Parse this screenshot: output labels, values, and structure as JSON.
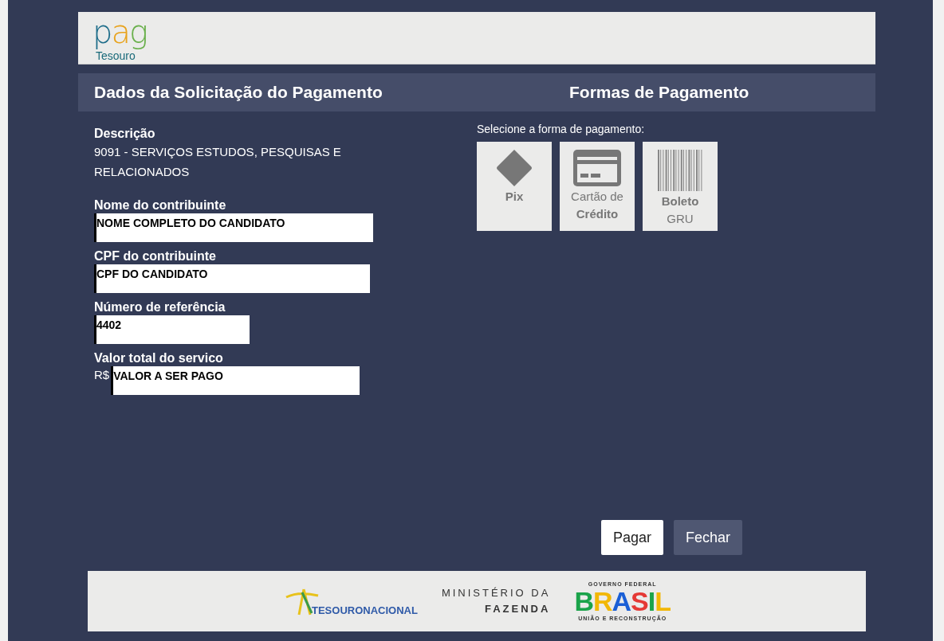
{
  "logo": {
    "wordmark": "pag",
    "subtitle": "Tesouro"
  },
  "headings": {
    "left": "Dados da Solicitação do Pagamento",
    "right": "Formas de Pagamento"
  },
  "description": {
    "label": "Descrição",
    "value": "9091 - SERVIÇOS ESTUDOS, PESQUISAS E RELACIONADOS"
  },
  "fields": [
    {
      "label": "Nome do contribuinte",
      "value": "NOME COMPLETO DO CANDIDATO"
    },
    {
      "label": "CPF do contribuinte",
      "value": "CPF DO CANDIDATO"
    },
    {
      "label": "Número de referência",
      "value": "4402"
    },
    {
      "label": "Valor total do servico",
      "prefix": "R$",
      "value": "VALOR A SER PAGO"
    }
  ],
  "payment": {
    "prompt": "Selecione a forma de pagamento:",
    "methods": [
      {
        "kind": "pix",
        "title": "Pix"
      },
      {
        "kind": "card",
        "line1": "Cartão de",
        "title": "Crédito"
      },
      {
        "kind": "boleto",
        "title": "Boleto",
        "line2": "GRU"
      }
    ]
  },
  "buttons": [
    {
      "label": "Pagar",
      "primary": true
    },
    {
      "label": "Fechar",
      "primary": false
    }
  ],
  "footer": {
    "tesouro": "TESOURONACIONAL",
    "ministry": [
      "MINISTÉRIO DA",
      "FAZENDA"
    ],
    "gov_top": "GOVERNO FEDERAL",
    "gov_word": "BRASIL",
    "gov_bottom": "UNIÃO E RECONSTRUÇÃO"
  }
}
